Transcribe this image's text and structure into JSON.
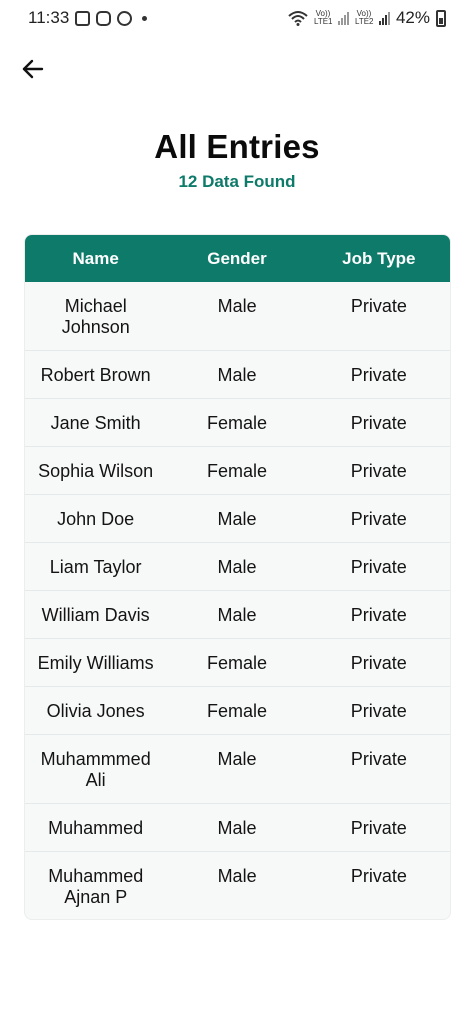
{
  "status_bar": {
    "time": "11:33",
    "battery_percent": "42%",
    "sim1_label": "Vo)) LTE1",
    "sim2_label": "Vo)) LTE2",
    "icons": [
      "gallery-icon",
      "instagram-icon",
      "bitcoin-icon",
      "dot-icon",
      "wifi-icon",
      "signal-icon",
      "battery-icon"
    ]
  },
  "header": {
    "back_icon": "arrow-left-icon",
    "title": "All Entries",
    "subtitle": "12 Data Found"
  },
  "table": {
    "columns": [
      "Name",
      "Gender",
      "Job Type"
    ],
    "rows": [
      {
        "name": "Michael Johnson",
        "gender": "Male",
        "job_type": "Private"
      },
      {
        "name": "Robert Brown",
        "gender": "Male",
        "job_type": "Private"
      },
      {
        "name": "Jane Smith",
        "gender": "Female",
        "job_type": "Private"
      },
      {
        "name": "Sophia Wilson",
        "gender": "Female",
        "job_type": "Private"
      },
      {
        "name": "John Doe",
        "gender": "Male",
        "job_type": "Private"
      },
      {
        "name": "Liam Taylor",
        "gender": "Male",
        "job_type": "Private"
      },
      {
        "name": "William Davis",
        "gender": "Male",
        "job_type": "Private"
      },
      {
        "name": "Emily Williams",
        "gender": "Female",
        "job_type": "Private"
      },
      {
        "name": "Olivia Jones",
        "gender": "Female",
        "job_type": "Private"
      },
      {
        "name": "Muhammmed Ali",
        "gender": "Male",
        "job_type": "Private"
      },
      {
        "name": "Muhammed",
        "gender": "Male",
        "job_type": "Private"
      },
      {
        "name": "Muhammed Ajnan P",
        "gender": "Male",
        "job_type": "Private"
      }
    ]
  },
  "colors": {
    "accent": "#0d7a6a",
    "header_text": "#ffffff",
    "row_bg": "#f7f8f8"
  }
}
